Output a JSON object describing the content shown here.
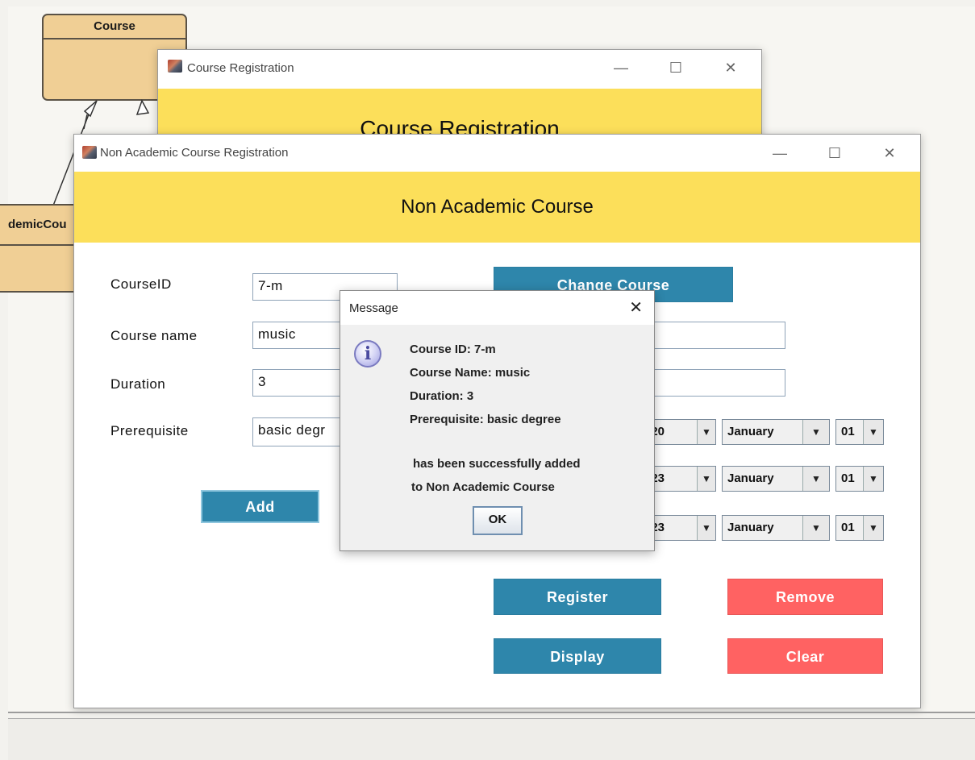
{
  "uml": {
    "course_title": "Course",
    "non_academic_partial": "demicCou"
  },
  "bg_window": {
    "title": "Course Registration",
    "header": "Course Registration"
  },
  "main_window": {
    "title": "Non Academic Course Registration",
    "header": "Non Academic Course",
    "labels": {
      "course_id": "CourseID",
      "course_name": "Course name",
      "duration": "Duration",
      "prerequisite": "Prerequisite"
    },
    "fields": {
      "course_id": "7-m",
      "course_name": "music",
      "duration": "3",
      "prerequisite": "basic degr"
    },
    "buttons": {
      "add": "Add",
      "change_course": "Change Course",
      "register": "Register",
      "remove": "Remove",
      "display": "Display",
      "clear": "Clear"
    },
    "date_rows": [
      {
        "year": "020",
        "month": "January",
        "day": "01"
      },
      {
        "year": "023",
        "month": "January",
        "day": "01"
      },
      {
        "year": "023",
        "month": "January",
        "day": "01"
      }
    ]
  },
  "dialog": {
    "title": "Message",
    "icon": "info-icon",
    "lines": [
      "Course ID: 7-m",
      "Course Name: music",
      "Duration: 3",
      "Prerequisite: basic degree"
    ],
    "message_lines": [
      "has been successfully added",
      "to Non Academic Course"
    ],
    "ok_label": "OK"
  },
  "colors": {
    "header_yellow": "#fcdf5a",
    "button_blue": "#2e86ab",
    "button_red": "#ff6262",
    "uml_fill": "#f0cf95"
  }
}
